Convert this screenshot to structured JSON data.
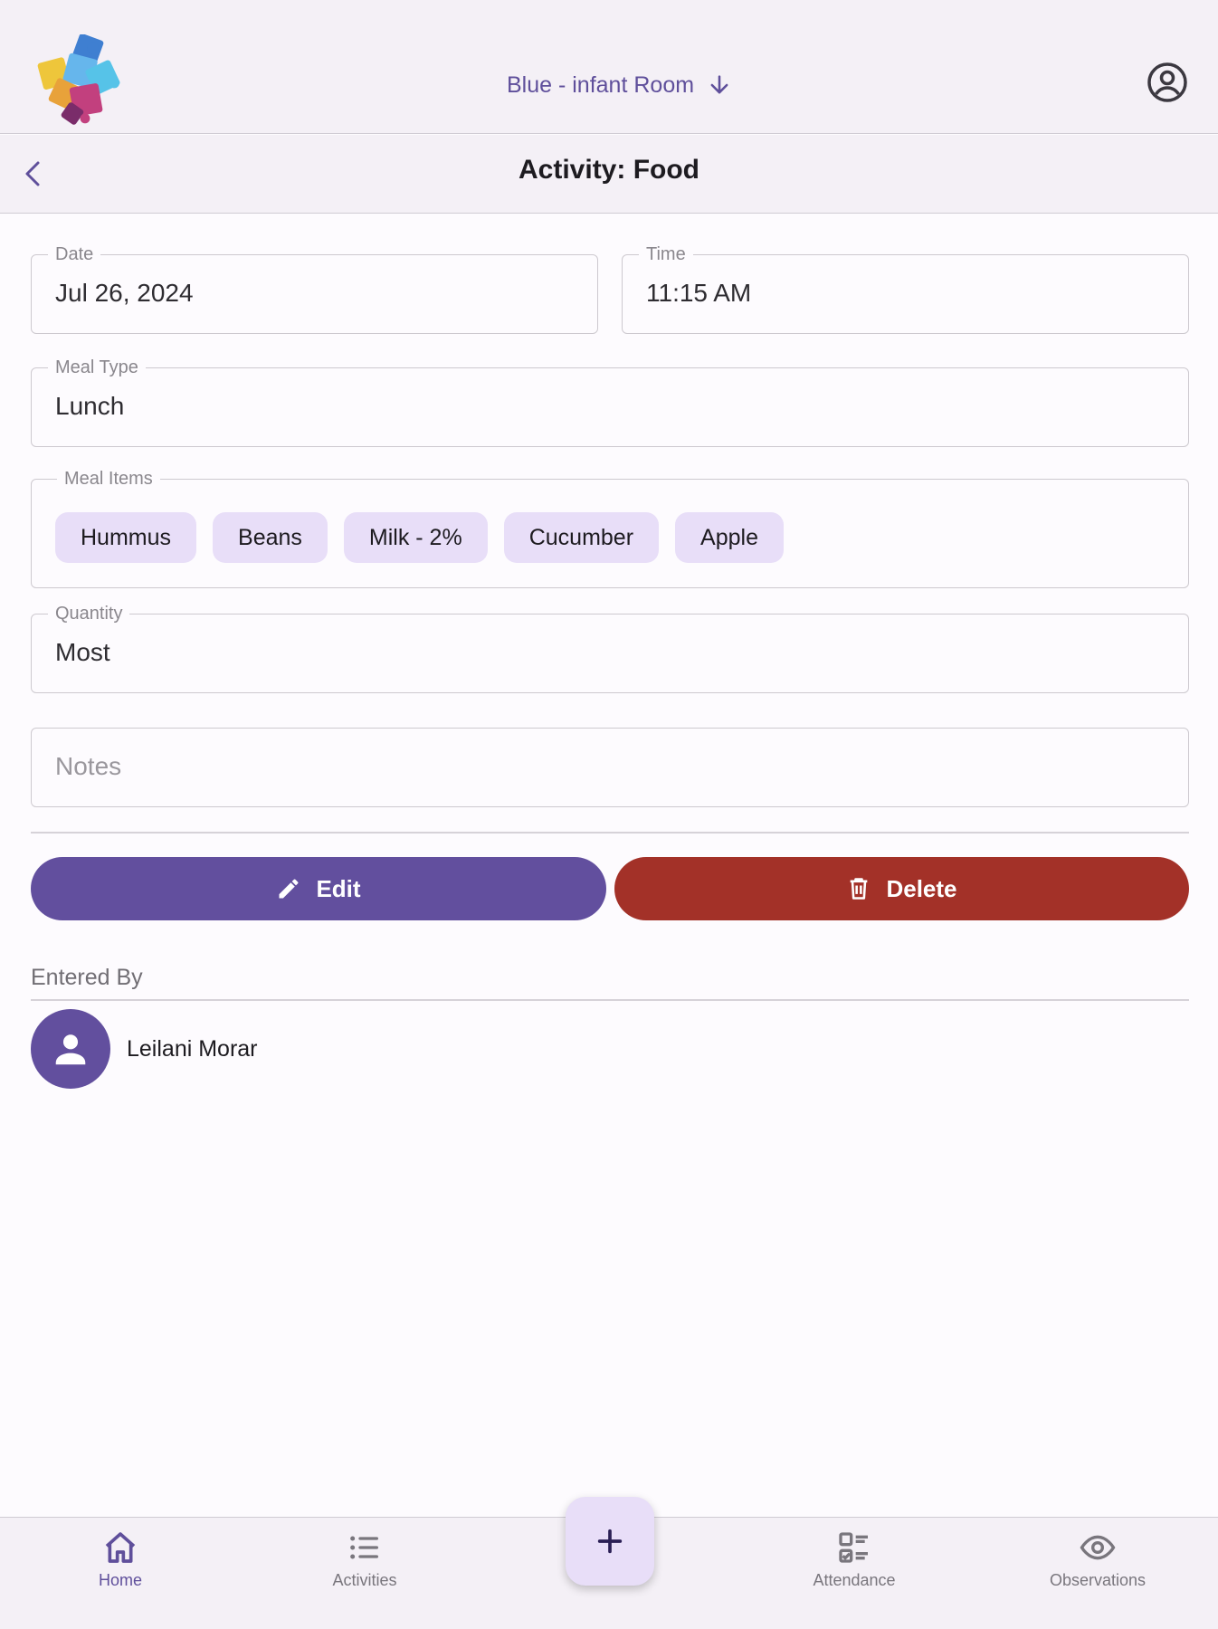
{
  "header": {
    "room_selector": "Blue - infant Room"
  },
  "subheader": {
    "title": "Activity: Food"
  },
  "form": {
    "date": {
      "label": "Date",
      "value": "Jul 26, 2024"
    },
    "time": {
      "label": "Time",
      "value": "11:15 AM"
    },
    "meal_type": {
      "label": "Meal Type",
      "value": "Lunch"
    },
    "meal_items": {
      "label": "Meal Items",
      "items": [
        "Hummus",
        "Beans",
        "Milk - 2%",
        "Cucumber",
        "Apple"
      ]
    },
    "quantity": {
      "label": "Quantity",
      "value": "Most"
    },
    "notes": {
      "placeholder": "Notes"
    }
  },
  "actions": {
    "edit_label": "Edit",
    "delete_label": "Delete"
  },
  "entered_by": {
    "heading": "Entered By",
    "name": "Leilani Morar"
  },
  "bottom_nav": {
    "items": [
      {
        "label": "Home",
        "icon": "home-icon",
        "active": true
      },
      {
        "label": "Activities",
        "icon": "list-icon",
        "active": false
      },
      {
        "label": "Attendance",
        "icon": "checklist-icon",
        "active": false
      },
      {
        "label": "Observations",
        "icon": "eye-icon",
        "active": false
      }
    ],
    "fab_icon": "plus-icon"
  },
  "colors": {
    "primary": "#624f9e",
    "danger": "#a33128",
    "chip": "#e8def8",
    "surface": "#f4f0f6"
  }
}
